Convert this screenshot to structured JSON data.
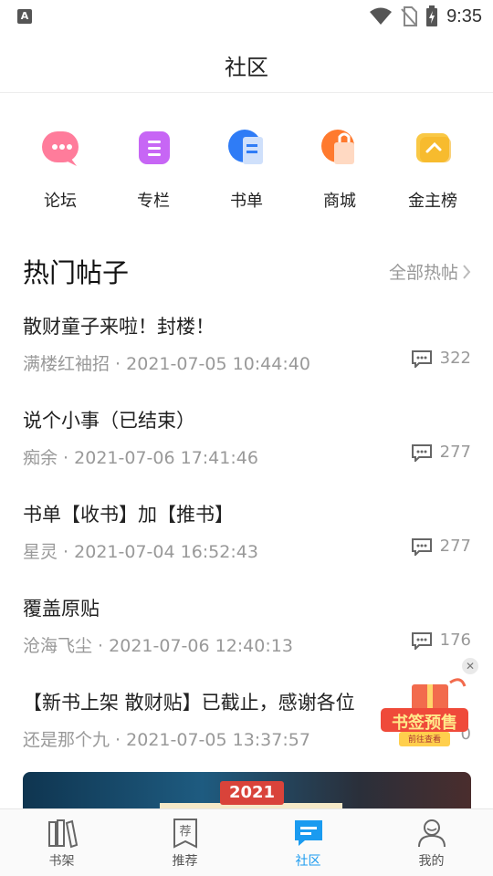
{
  "status_bar": {
    "time": "9:35",
    "notification_icon": "a-icon"
  },
  "header": {
    "title": "社区"
  },
  "quick_nav": [
    {
      "label": "论坛",
      "icon": "forum-icon",
      "color": "#ff5a7a"
    },
    {
      "label": "专栏",
      "icon": "column-icon",
      "color": "#c24bf5"
    },
    {
      "label": "书单",
      "icon": "booklist-icon",
      "color": "#2f7cf6"
    },
    {
      "label": "商城",
      "icon": "shop-icon",
      "color": "#ff7a2e"
    },
    {
      "label": "金主榜",
      "icon": "ranking-icon",
      "color": "#f5b320"
    }
  ],
  "hot_posts": {
    "title": "热门帖子",
    "more_label": "全部热帖",
    "items": [
      {
        "title": "散财童子来啦！封楼！",
        "author": "满楼红袖招",
        "time": "2021-07-05 10:44:40",
        "comments": "322"
      },
      {
        "title": "说个小事（已结束）",
        "author": "痴余",
        "time": "2021-07-06 17:41:46",
        "comments": "277"
      },
      {
        "title": "书单【收书】加【推书】",
        "author": "星灵",
        "time": "2021-07-04 16:52:43",
        "comments": "277"
      },
      {
        "title": "覆盖原贴",
        "author": "沧海飞尘",
        "time": "2021-07-06 12:40:13",
        "comments": "176"
      },
      {
        "title": "【新书上架 散财贴】已截止，感谢各位",
        "author": "还是那个九",
        "time": "2021-07-05 13:37:57",
        "comments": "0"
      }
    ]
  },
  "float_ad": {
    "title": "书签预售",
    "subtitle": "前往查看"
  },
  "banner": {
    "tag": "2021"
  },
  "tabbar": [
    {
      "label": "书架",
      "icon": "bookshelf-icon",
      "active": false
    },
    {
      "label": "推荐",
      "icon": "recommend-icon",
      "active": false
    },
    {
      "label": "社区",
      "icon": "community-icon",
      "active": true
    },
    {
      "label": "我的",
      "icon": "profile-icon",
      "active": false
    }
  ],
  "colors": {
    "accent": "#1a9bf0",
    "meta_text": "#999999"
  }
}
